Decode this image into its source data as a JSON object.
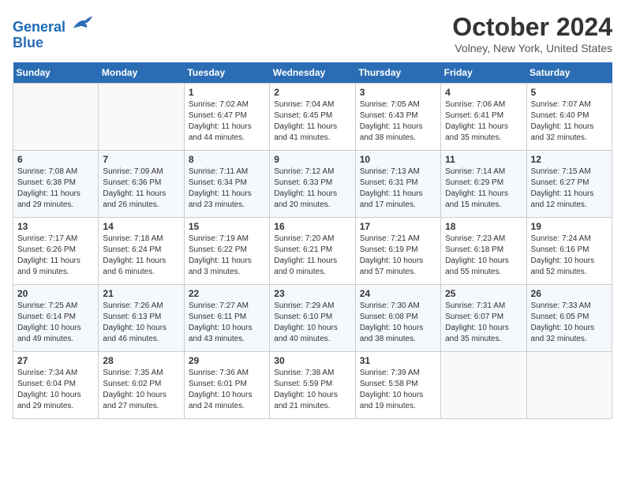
{
  "header": {
    "logo_line1": "General",
    "logo_line2": "Blue",
    "month_title": "October 2024",
    "location": "Volney, New York, United States"
  },
  "weekdays": [
    "Sunday",
    "Monday",
    "Tuesday",
    "Wednesday",
    "Thursday",
    "Friday",
    "Saturday"
  ],
  "weeks": [
    [
      {
        "day": "",
        "info": ""
      },
      {
        "day": "",
        "info": ""
      },
      {
        "day": "1",
        "info": "Sunrise: 7:02 AM\nSunset: 6:47 PM\nDaylight: 11 hours and 44 minutes."
      },
      {
        "day": "2",
        "info": "Sunrise: 7:04 AM\nSunset: 6:45 PM\nDaylight: 11 hours and 41 minutes."
      },
      {
        "day": "3",
        "info": "Sunrise: 7:05 AM\nSunset: 6:43 PM\nDaylight: 11 hours and 38 minutes."
      },
      {
        "day": "4",
        "info": "Sunrise: 7:06 AM\nSunset: 6:41 PM\nDaylight: 11 hours and 35 minutes."
      },
      {
        "day": "5",
        "info": "Sunrise: 7:07 AM\nSunset: 6:40 PM\nDaylight: 11 hours and 32 minutes."
      }
    ],
    [
      {
        "day": "6",
        "info": "Sunrise: 7:08 AM\nSunset: 6:38 PM\nDaylight: 11 hours and 29 minutes."
      },
      {
        "day": "7",
        "info": "Sunrise: 7:09 AM\nSunset: 6:36 PM\nDaylight: 11 hours and 26 minutes."
      },
      {
        "day": "8",
        "info": "Sunrise: 7:11 AM\nSunset: 6:34 PM\nDaylight: 11 hours and 23 minutes."
      },
      {
        "day": "9",
        "info": "Sunrise: 7:12 AM\nSunset: 6:33 PM\nDaylight: 11 hours and 20 minutes."
      },
      {
        "day": "10",
        "info": "Sunrise: 7:13 AM\nSunset: 6:31 PM\nDaylight: 11 hours and 17 minutes."
      },
      {
        "day": "11",
        "info": "Sunrise: 7:14 AM\nSunset: 6:29 PM\nDaylight: 11 hours and 15 minutes."
      },
      {
        "day": "12",
        "info": "Sunrise: 7:15 AM\nSunset: 6:27 PM\nDaylight: 11 hours and 12 minutes."
      }
    ],
    [
      {
        "day": "13",
        "info": "Sunrise: 7:17 AM\nSunset: 6:26 PM\nDaylight: 11 hours and 9 minutes."
      },
      {
        "day": "14",
        "info": "Sunrise: 7:18 AM\nSunset: 6:24 PM\nDaylight: 11 hours and 6 minutes."
      },
      {
        "day": "15",
        "info": "Sunrise: 7:19 AM\nSunset: 6:22 PM\nDaylight: 11 hours and 3 minutes."
      },
      {
        "day": "16",
        "info": "Sunrise: 7:20 AM\nSunset: 6:21 PM\nDaylight: 11 hours and 0 minutes."
      },
      {
        "day": "17",
        "info": "Sunrise: 7:21 AM\nSunset: 6:19 PM\nDaylight: 10 hours and 57 minutes."
      },
      {
        "day": "18",
        "info": "Sunrise: 7:23 AM\nSunset: 6:18 PM\nDaylight: 10 hours and 55 minutes."
      },
      {
        "day": "19",
        "info": "Sunrise: 7:24 AM\nSunset: 6:16 PM\nDaylight: 10 hours and 52 minutes."
      }
    ],
    [
      {
        "day": "20",
        "info": "Sunrise: 7:25 AM\nSunset: 6:14 PM\nDaylight: 10 hours and 49 minutes."
      },
      {
        "day": "21",
        "info": "Sunrise: 7:26 AM\nSunset: 6:13 PM\nDaylight: 10 hours and 46 minutes."
      },
      {
        "day": "22",
        "info": "Sunrise: 7:27 AM\nSunset: 6:11 PM\nDaylight: 10 hours and 43 minutes."
      },
      {
        "day": "23",
        "info": "Sunrise: 7:29 AM\nSunset: 6:10 PM\nDaylight: 10 hours and 40 minutes."
      },
      {
        "day": "24",
        "info": "Sunrise: 7:30 AM\nSunset: 6:08 PM\nDaylight: 10 hours and 38 minutes."
      },
      {
        "day": "25",
        "info": "Sunrise: 7:31 AM\nSunset: 6:07 PM\nDaylight: 10 hours and 35 minutes."
      },
      {
        "day": "26",
        "info": "Sunrise: 7:33 AM\nSunset: 6:05 PM\nDaylight: 10 hours and 32 minutes."
      }
    ],
    [
      {
        "day": "27",
        "info": "Sunrise: 7:34 AM\nSunset: 6:04 PM\nDaylight: 10 hours and 29 minutes."
      },
      {
        "day": "28",
        "info": "Sunrise: 7:35 AM\nSunset: 6:02 PM\nDaylight: 10 hours and 27 minutes."
      },
      {
        "day": "29",
        "info": "Sunrise: 7:36 AM\nSunset: 6:01 PM\nDaylight: 10 hours and 24 minutes."
      },
      {
        "day": "30",
        "info": "Sunrise: 7:38 AM\nSunset: 5:59 PM\nDaylight: 10 hours and 21 minutes."
      },
      {
        "day": "31",
        "info": "Sunrise: 7:39 AM\nSunset: 5:58 PM\nDaylight: 10 hours and 19 minutes."
      },
      {
        "day": "",
        "info": ""
      },
      {
        "day": "",
        "info": ""
      }
    ]
  ]
}
